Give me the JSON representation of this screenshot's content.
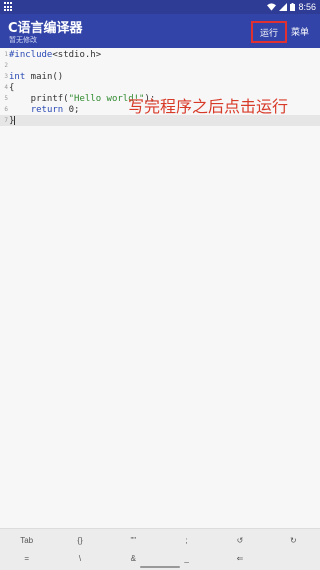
{
  "status": {
    "time": "8:56"
  },
  "app": {
    "title": "C语言编译器",
    "subtitle": "暂无修改",
    "run_label": "运行",
    "menu_label": "菜单"
  },
  "editor": {
    "lines": [
      {
        "num": "1",
        "parts": [
          [
            "kw-pre",
            "#include"
          ],
          [
            "plain",
            "<stdio.h>"
          ]
        ]
      },
      {
        "num": "2",
        "parts": []
      },
      {
        "num": "3",
        "parts": [
          [
            "kw",
            "int"
          ],
          [
            "plain",
            " main()"
          ]
        ]
      },
      {
        "num": "4",
        "parts": [
          [
            "plain",
            "{"
          ]
        ]
      },
      {
        "num": "5",
        "parts": [
          [
            "plain",
            "    printf("
          ],
          [
            "str",
            "\"Hello world!\""
          ],
          [
            "plain",
            ");"
          ]
        ]
      },
      {
        "num": "6",
        "parts": [
          [
            "plain",
            "    "
          ],
          [
            "kw",
            "return"
          ],
          [
            "plain",
            " 0;"
          ]
        ]
      },
      {
        "num": "7",
        "parts": [
          [
            "plain",
            "}"
          ]
        ]
      }
    ]
  },
  "annotation": "写完程序之后点击运行",
  "keys": {
    "row1": [
      "Tab",
      "{}",
      "\"\"",
      ";",
      "↺",
      "↻"
    ],
    "row2": [
      "=",
      "\\",
      "&",
      "_",
      "⇐",
      ""
    ]
  }
}
